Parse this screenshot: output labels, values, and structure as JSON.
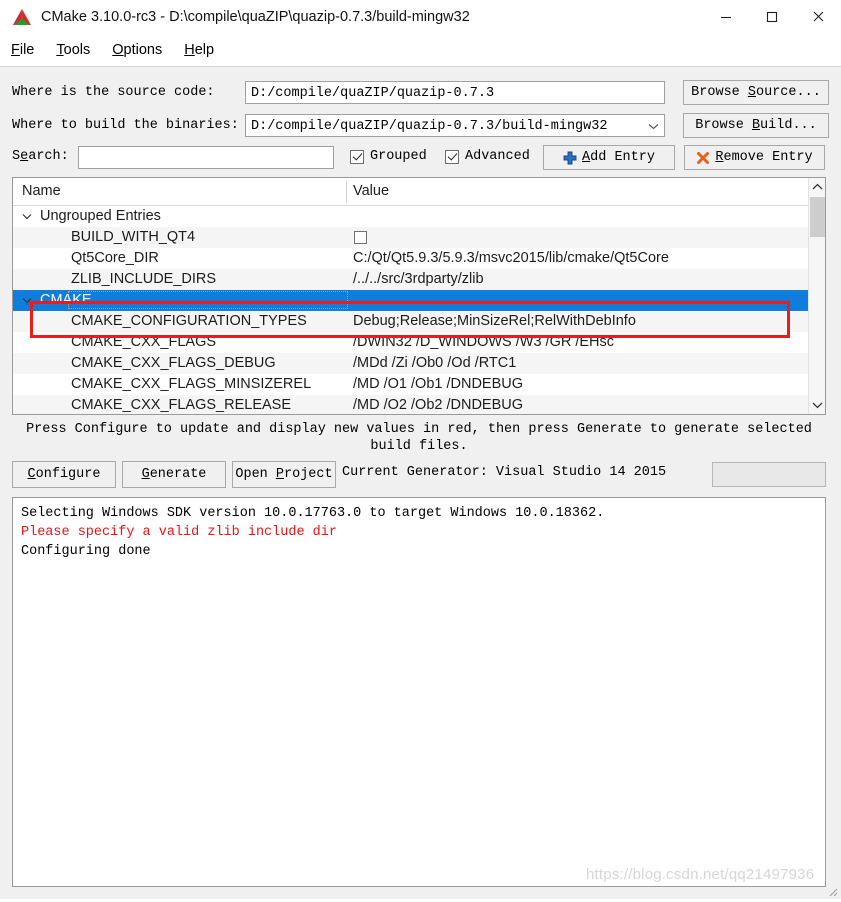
{
  "window": {
    "title": "CMake 3.10.0-rc3 - D:\\compile\\quaZIP\\quazip-0.7.3/build-mingw32",
    "icon": "cmake-logo-icon",
    "controls": {
      "minimize": "minimize-icon",
      "maximize": "maximize-icon",
      "close": "close-icon"
    }
  },
  "menubar": {
    "items": [
      {
        "label": "File",
        "mnemonic": "F"
      },
      {
        "label": "Tools",
        "mnemonic": "T"
      },
      {
        "label": "Options",
        "mnemonic": "O"
      },
      {
        "label": "Help",
        "mnemonic": "H"
      }
    ]
  },
  "paths": {
    "source_label": "Where is the source code:",
    "source_value": "D:/compile/quaZIP/quazip-0.7.3",
    "browse_source_label": "Browse Source...",
    "build_label": "Where to build the binaries:",
    "build_value": "D:/compile/quaZIP/quazip-0.7.3/build-mingw32",
    "browse_build_label": "Browse Build..."
  },
  "search": {
    "label": "Search:",
    "value": "",
    "placeholder": ""
  },
  "toolbar": {
    "grouped_label": "Grouped",
    "grouped_checked": true,
    "advanced_label": "Advanced",
    "advanced_checked": true,
    "add_entry_label": "Add Entry",
    "remove_entry_label": "Remove Entry"
  },
  "table": {
    "columns": [
      "Name",
      "Value"
    ],
    "rows": [
      {
        "name": "Ungrouped Entries",
        "value": "",
        "kind": "group",
        "expanded": true,
        "selected": false,
        "stripe": "white"
      },
      {
        "name": "BUILD_WITH_QT4",
        "value": "",
        "kind": "checkbox",
        "checked": false,
        "selected": false,
        "stripe": "alt"
      },
      {
        "name": "Qt5Core_DIR",
        "value": "C:/Qt/Qt5.9.3/5.9.3/msvc2015/lib/cmake/Qt5Core",
        "kind": "entry",
        "selected": false,
        "stripe": "white"
      },
      {
        "name": "ZLIB_INCLUDE_DIRS",
        "value": "/../../src/3rdparty/zlib",
        "kind": "entry",
        "selected": false,
        "stripe": "alt"
      },
      {
        "name": "CMAKE",
        "value": "",
        "kind": "group",
        "expanded": true,
        "selected": true,
        "stripe": "white"
      },
      {
        "name": "CMAKE_CONFIGURATION_TYPES",
        "value": "Debug;Release;MinSizeRel;RelWithDebInfo",
        "kind": "entry",
        "selected": false,
        "stripe": "alt"
      },
      {
        "name": "CMAKE_CXX_FLAGS",
        "value": "/DWIN32 /D_WINDOWS /W3 /GR /EHsc",
        "kind": "entry",
        "selected": false,
        "stripe": "white"
      },
      {
        "name": "CMAKE_CXX_FLAGS_DEBUG",
        "value": "/MDd /Zi /Ob0 /Od /RTC1",
        "kind": "entry",
        "selected": false,
        "stripe": "alt"
      },
      {
        "name": "CMAKE_CXX_FLAGS_MINSIZEREL",
        "value": "/MD /O1 /Ob1 /DNDEBUG",
        "kind": "entry",
        "selected": false,
        "stripe": "white"
      },
      {
        "name": "CMAKE_CXX_FLAGS_RELEASE",
        "value": "/MD /O2 /Ob2 /DNDEBUG",
        "kind": "entry",
        "selected": false,
        "stripe": "alt"
      }
    ]
  },
  "hint": "Press Configure to update and display new values in red, then press Generate to generate selected build files.",
  "actions": {
    "configure_label": "Configure",
    "generate_label": "Generate",
    "open_project_label": "Open Project",
    "generator_text": "Current Generator: Visual Studio 14 2015",
    "progress_value": ""
  },
  "log": {
    "lines": [
      {
        "text": "Selecting Windows SDK version 10.0.17763.0 to target Windows 10.0.18362.",
        "error": false
      },
      {
        "text": "Please specify a valid zlib include dir",
        "error": true
      },
      {
        "text": "Configuring done",
        "error": false
      }
    ]
  },
  "watermark": "https://blog.csdn.net/qq21497936",
  "colors": {
    "selection": "#0f7ddb",
    "error_text": "#ee1111",
    "annotation": "#ee1b1b",
    "window_bg": "#f0f0f0"
  }
}
